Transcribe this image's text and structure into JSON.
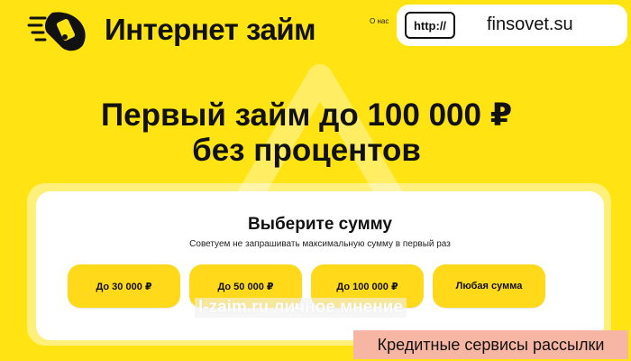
{
  "header": {
    "brand": "Интернет займ",
    "about_link": "О нас",
    "url_prefix": "http://",
    "url_text": "finsovet.su"
  },
  "hero": {
    "title_line1": "Первый займ до 100 000 ₽",
    "title_line2": "без процентов"
  },
  "amount_picker": {
    "title": "Выберите сумму",
    "subtitle": "Советуем не запрашивать максимальную сумму в первый раз",
    "options": [
      "До 30 000 ₽",
      "До 50 000 ₽",
      "До 100 000 ₽",
      "Любая сумма"
    ]
  },
  "watermark": "l-zaim.ru личное мнение",
  "promo_banner": "Кредитные сервисы рассылки",
  "colors": {
    "background": "#ffe312",
    "button": "#ffd91a",
    "card": "#ffffff",
    "promo_banner": "#f7b6a3"
  },
  "icons": {
    "logo": "hand-with-phone-logo-icon"
  }
}
